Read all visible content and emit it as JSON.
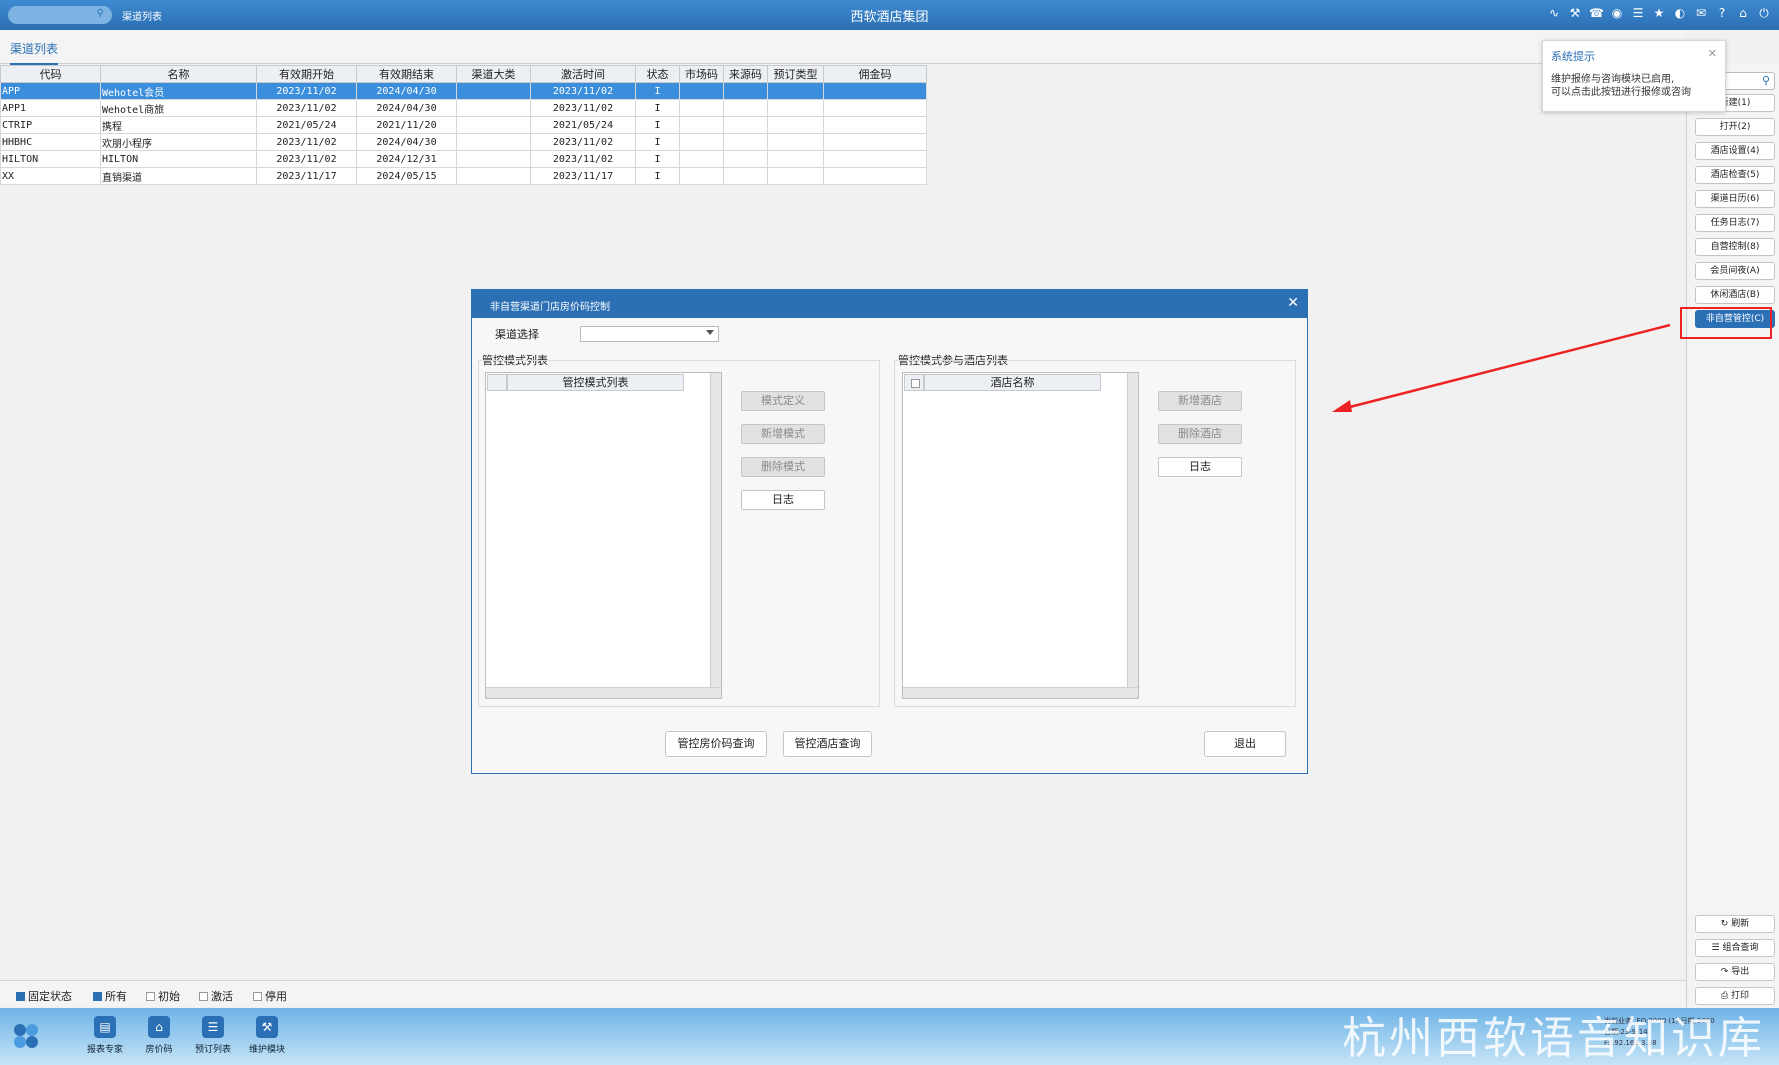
{
  "topbar": {
    "search_icon": "search-icon",
    "breadcrumb": "渠道列表",
    "title": "西软酒店集团",
    "icons": [
      "wifi-icon",
      "tools-icon",
      "phone-icon",
      "palette-icon",
      "menu-icon",
      "star-icon",
      "contrast-icon",
      "mail-icon",
      "help-icon",
      "home-icon",
      "power-icon"
    ]
  },
  "tab": {
    "label": "渠道列表"
  },
  "grid": {
    "headers": [
      "代码",
      "名称",
      "有效期开始",
      "有效期结束",
      "渠道大类",
      "激活时间",
      "状态",
      "市场码",
      "来源码",
      "预订类型",
      "佣金码"
    ],
    "rows": [
      [
        "APP",
        "Wehotel会员",
        "2023/11/02",
        "2024/04/30",
        "",
        "2023/11/02",
        "I",
        "",
        "",
        "",
        ""
      ],
      [
        "APP1",
        "Wehotel商旅",
        "2023/11/02",
        "2024/04/30",
        "",
        "2023/11/02",
        "I",
        "",
        "",
        "",
        ""
      ],
      [
        "CTRIP",
        "携程",
        "2021/05/24",
        "2021/11/20",
        "",
        "2021/05/24",
        "I",
        "",
        "",
        "",
        ""
      ],
      [
        "HHBHC",
        "欢朋小程序",
        "2023/11/02",
        "2024/04/30",
        "",
        "2023/11/02",
        "I",
        "",
        "",
        "",
        ""
      ],
      [
        "HILTON",
        "HILTON",
        "2023/11/02",
        "2024/12/31",
        "",
        "2023/11/02",
        "I",
        "",
        "",
        "",
        ""
      ],
      [
        "XX",
        "直销渠道",
        "2023/11/17",
        "2024/05/15",
        "",
        "2023/11/17",
        "I",
        "",
        "",
        "",
        ""
      ]
    ]
  },
  "tooltip": {
    "title": "系统提示",
    "line1": "维护报修与咨询模块已启用,",
    "line2": "可以点击此按钮进行报修或咨询"
  },
  "right_panel": {
    "buttons": [
      "新建(1)",
      "打开(2)",
      "酒店设置(4)",
      "酒店检查(5)",
      "渠道日历(6)",
      "任务日志(7)",
      "自营控制(8)",
      "会员间夜(A)",
      "休闲酒店(B)",
      "非自营管控(C)"
    ],
    "bottom_buttons": [
      "刷新",
      "组合查询",
      "导出",
      "打印"
    ]
  },
  "modal": {
    "title": "非自营渠道门店房价码控制",
    "channel_label": "渠道选择",
    "channel_value": "",
    "left_group_label": "管控模式列表",
    "left_list_header": "管控模式列表",
    "left_buttons": {
      "define": "模式定义",
      "add": "新增模式",
      "delete": "删除模式",
      "log": "日志"
    },
    "right_group_label": "管控模式参与酒店列表",
    "right_list_header": "酒店名称",
    "right_buttons": {
      "add": "新增酒店",
      "delete": "删除酒店",
      "log": "日志"
    },
    "footer": {
      "rate_query": "管控房价码查询",
      "hotel_query": "管控酒店查询",
      "exit": "退出"
    }
  },
  "filters": [
    {
      "label": "固定状态",
      "checked": true
    },
    {
      "label": "所有",
      "checked": true
    },
    {
      "label": "初始",
      "checked": false
    },
    {
      "label": "激活",
      "checked": false
    },
    {
      "label": "停用",
      "checked": false
    }
  ],
  "dock": {
    "items": [
      "报表专家",
      "房价码",
      "预订列表",
      "维护模块"
    ],
    "watermark": "杭州西软语音知识库",
    "info_line1": "当前业务: FO:2000 (1) 日期:2000",
    "info_line2": "日期:23-9-14",
    "info_line3": "F:192.168.3.38"
  },
  "colors": {
    "accent": "#2b6fb4",
    "selection": "#3b8edb",
    "highlight_box": "#ee2222"
  }
}
